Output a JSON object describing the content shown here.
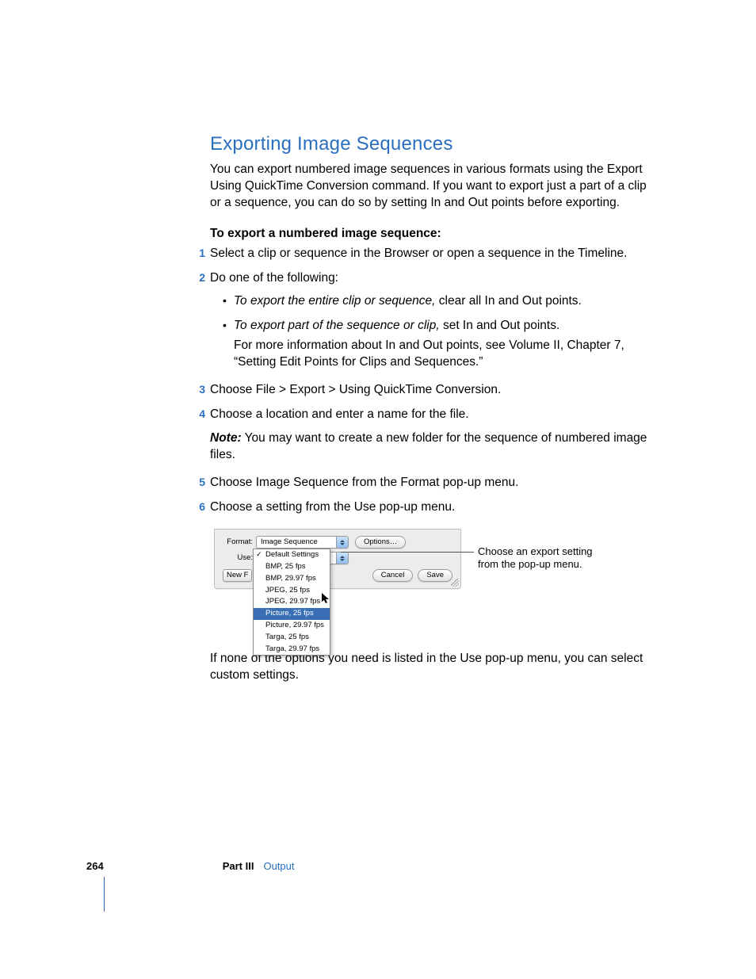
{
  "heading": "Exporting Image Sequences",
  "intro": "You can export numbered image sequences in various formats using the Export Using QuickTime Conversion command. If you want to export just a part of a clip or a sequence, you can do so by setting In and Out points before exporting.",
  "subhead": "To export a numbered image sequence:",
  "steps": {
    "s1": {
      "n": "1",
      "text": "Select a clip or sequence in the Browser or open a sequence in the Timeline."
    },
    "s2": {
      "n": "2",
      "text": "Do one of the following:"
    },
    "s2b1_lead": "To export the entire clip or sequence,",
    "s2b1_rest": " clear all In and Out points.",
    "s2b2_lead": "To export part of the sequence or clip,",
    "s2b2_rest": " set In and Out points.",
    "s2b2_more": "For more information about In and Out points, see Volume II, Chapter 7, “Setting Edit Points for Clips and Sequences.”",
    "s3": {
      "n": "3",
      "text": "Choose File > Export > Using QuickTime Conversion."
    },
    "s4": {
      "n": "4",
      "text": "Choose a location and enter a name for the file."
    },
    "s4_note_lead": "Note:",
    "s4_note": "  You may want to create a new folder for the sequence of numbered image files.",
    "s5": {
      "n": "5",
      "text": "Choose Image Sequence from the Format pop-up menu."
    },
    "s6": {
      "n": "6",
      "text": "Choose a setting from the Use pop-up menu."
    }
  },
  "after": "If none of the options you need is listed in the Use pop-up menu, you can select custom settings.",
  "dialog": {
    "format_label": "Format:",
    "format_value": "Image Sequence",
    "use_label": "Use:",
    "options_btn": "Options…",
    "new_folder_btn": "New F",
    "cancel_btn": "Cancel",
    "save_btn": "Save",
    "menu": [
      "Default Settings",
      "BMP, 25 fps",
      "BMP, 29.97 fps",
      "JPEG, 25 fps",
      "JPEG, 29.97 fps",
      "Picture, 25 fps",
      "Picture, 29.97 fps",
      "Targa, 25 fps",
      "Targa, 29.97 fps"
    ],
    "checked_index": 0,
    "selected_index": 5
  },
  "callout": "Choose an export setting from the pop-up menu.",
  "footer": {
    "page": "264",
    "part": "Part III",
    "section": "Output"
  }
}
